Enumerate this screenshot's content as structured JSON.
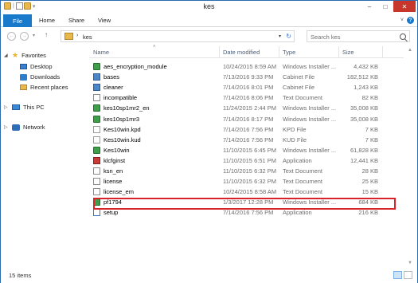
{
  "window": {
    "title": "kes"
  },
  "titlebar": {
    "window_buttons": {
      "minimize": "–",
      "maximize": "□",
      "close": "✕"
    }
  },
  "ribbon": {
    "tabs": [
      "File",
      "Home",
      "Share",
      "View"
    ],
    "help": "?"
  },
  "address": {
    "path": [
      "kes"
    ],
    "search_placeholder": "Search kes"
  },
  "nav": {
    "favorites_label": "Favorites",
    "favorites": [
      "Desktop",
      "Downloads",
      "Recent places"
    ],
    "this_pc": "This PC",
    "network": "Network"
  },
  "columns": {
    "name": "Name",
    "date": "Date modified",
    "type": "Type",
    "size": "Size"
  },
  "files": [
    {
      "name": "aes_encryption_module",
      "date": "10/24/2015 8:59 AM",
      "type": "Windows Installer ...",
      "size": "4,432 KB",
      "icon": "msi"
    },
    {
      "name": "bases",
      "date": "7/13/2016 9:33 PM",
      "type": "Cabinet File",
      "size": "182,512 KB",
      "icon": "cab"
    },
    {
      "name": "cleaner",
      "date": "7/14/2016 8:01 PM",
      "type": "Cabinet File",
      "size": "1,243 KB",
      "icon": "cab"
    },
    {
      "name": "incompatible",
      "date": "7/14/2016 8:06 PM",
      "type": "Text Document",
      "size": "82 KB",
      "icon": "txt"
    },
    {
      "name": "kes10sp1mr2_en",
      "date": "11/24/2015 2:44 PM",
      "type": "Windows Installer ...",
      "size": "35,008 KB",
      "icon": "msi"
    },
    {
      "name": "kes10sp1mr3",
      "date": "7/14/2016 8:17 PM",
      "type": "Windows Installer ...",
      "size": "35,008 KB",
      "icon": "msi"
    },
    {
      "name": "Kes10win.kpd",
      "date": "7/14/2016 7:56 PM",
      "type": "KPD File",
      "size": "7 KB",
      "icon": "blank"
    },
    {
      "name": "Kes10win.kud",
      "date": "7/14/2016 7:56 PM",
      "type": "KUD File",
      "size": "7 KB",
      "icon": "blank"
    },
    {
      "name": "Kes10win",
      "date": "11/10/2015 6:45 PM",
      "type": "Windows Installer ...",
      "size": "61,828 KB",
      "icon": "msi"
    },
    {
      "name": "klcfginst",
      "date": "11/10/2015 6:51 PM",
      "type": "Application",
      "size": "12,441 KB",
      "icon": "app2"
    },
    {
      "name": "ksn_en",
      "date": "11/10/2015 6:32 PM",
      "type": "Text Document",
      "size": "28 KB",
      "icon": "txt"
    },
    {
      "name": "license",
      "date": "11/10/2015 6:32 PM",
      "type": "Text Document",
      "size": "25 KB",
      "icon": "txt"
    },
    {
      "name": "license_em",
      "date": "10/24/2015 8:58 AM",
      "type": "Text Document",
      "size": "15 KB",
      "icon": "txt"
    },
    {
      "name": "pf1794",
      "date": "1/3/2017 12:28 PM",
      "type": "Windows Installer ...",
      "size": "684 KB",
      "icon": "msi"
    },
    {
      "name": "setup",
      "date": "7/14/2016 7:56 PM",
      "type": "Application",
      "size": "216 KB",
      "icon": "app"
    }
  ],
  "status": {
    "item_count": "15 items"
  },
  "colors": {
    "accent": "#1979ca",
    "highlight_border": "#d9232b",
    "close": "#c7362b"
  }
}
